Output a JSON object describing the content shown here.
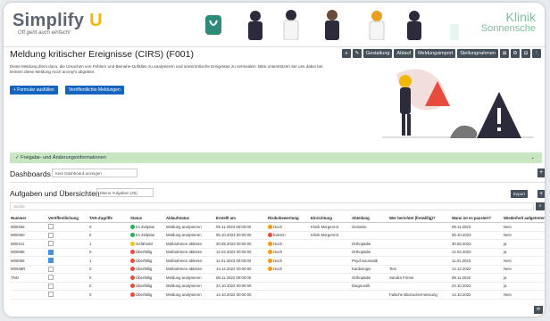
{
  "header": {
    "logo_text": "Simplify",
    "logo_accent": "U",
    "slogan": "Oft geht auch einfach!",
    "clinic_line1": "Klinik",
    "clinic_line2": "Sonnensche"
  },
  "page": {
    "title": "Meldung kritischer Ereignisse (CIRS) (F001)",
    "description": "Diese Meldung dient dazu, die Ursachen von Fehlern und Beinahe-Unfällen zu analysieren und somit kritische Ereignisse zu vermeiden. Bitte unterstützen Sie uns dabei bei keinem diese Meldung Auch anonym abgeben.",
    "btn_fill": "+ Formular ausfüllen",
    "btn_published": "Veröffentlichte Meldungen"
  },
  "toolbar": [
    "≡",
    "✎",
    "Gestaltung",
    "Ablauf",
    "Meldungsimport",
    "Stellungnahmen",
    "⊞",
    "⚙",
    "⊟",
    "⋮"
  ],
  "banner": {
    "label": "Freigabe- und Änderungsinformationen",
    "chevron": "⌄"
  },
  "dashboards": {
    "label": "Dashboards",
    "select": "Kein Dashboard anzeigen",
    "plus": "+"
  },
  "tasks": {
    "label": "Aufgaben und Übersichten",
    "select": "Meine Aufgaben (25)",
    "export": "Export",
    "plus": "+"
  },
  "search_placeholder": "Suche",
  "table": {
    "headers": [
      "Nummer",
      "Veröffentlichung",
      "TAN-Zugriffe",
      "Status",
      "Ablaufstatus",
      "Erstellt am",
      "Risikobewertung",
      "Einrichtung",
      "Abteilung",
      "Wer berichtet (freiwillig)?",
      "Wann ist es passiert?",
      "Wiederholt aufgetreten?"
    ],
    "rows": [
      {
        "nr": "M00466",
        "pub": false,
        "tan": "0",
        "status": "Im Zeitplan",
        "sc": "#27ae60",
        "ablauf": "Meldung analysieren",
        "erstellt": "09.11.2023 00:00:00",
        "risk": "Hoch",
        "rc": "#f39c12",
        "einr": "Klinik Morgenrot",
        "abt": "Geriatrie",
        "wer": "",
        "wann": "09.11.2023",
        "wied": "Nein"
      },
      {
        "nr": "M00450",
        "pub": false,
        "tan": "0",
        "status": "Im Zeitplan",
        "sc": "#27ae60",
        "ablauf": "Meldung analysieren",
        "erstellt": "05.10.2023 00:00:00",
        "risk": "Extrem",
        "rc": "#e74c3c",
        "einr": "Klinik Morgenrot",
        "abt": "",
        "wer": "",
        "wann": "05.10.2023",
        "wied": "Nein"
      },
      {
        "nr": "M00411",
        "pub": false,
        "tan": "1",
        "status": "Gefährdet",
        "sc": "#f1c40f",
        "ablauf": "Maßnahmen ableiten",
        "erstellt": "30.05.2023 00:00:00",
        "risk": "Hoch",
        "rc": "#f39c12",
        "einr": "",
        "abt": "Orthopädie",
        "wer": "",
        "wann": "30.05.2023",
        "wied": "ja"
      },
      {
        "nr": "M00086",
        "pub": true,
        "tan": "0",
        "status": "Überfällig",
        "sc": "#e74c3c",
        "ablauf": "Maßnahmen ableiten",
        "erstellt": "12.04.2023 00:00:00",
        "risk": "Hoch",
        "rc": "#f39c12",
        "einr": "",
        "abt": "Orthopädie",
        "wer": "",
        "wann": "12.04.2023",
        "wied": "ja"
      },
      {
        "nr": "M00056",
        "pub": true,
        "tan": "1",
        "status": "Überfällig",
        "sc": "#e74c3c",
        "ablauf": "Maßnahmen ableiten",
        "erstellt": "11.01.2023 00:00:00",
        "risk": "Hoch",
        "rc": "#f39c12",
        "einr": "",
        "abt": "Psychosomatik",
        "wer": "",
        "wann": "11.01.2023",
        "wied": "Nein"
      },
      {
        "nr": "M0049R",
        "pub": false,
        "tan": "0",
        "status": "Überfällig",
        "sc": "#e74c3c",
        "ablauf": "Maßnahmen ableiten",
        "erstellt": "14.12.2022 00:00:00",
        "risk": "Hoch",
        "rc": "#f39c12",
        "einr": "",
        "abt": "Kardiologie",
        "wer": "Test",
        "wann": "14.12.2022",
        "wied": "Nein"
      },
      {
        "nr": "TNO",
        "pub": false,
        "tan": "0",
        "status": "Überfällig",
        "sc": "#e74c3c",
        "ablauf": "Meldung analysieren",
        "erstellt": "08.11.2022 00:00:00",
        "risk": "",
        "rc": "",
        "einr": "",
        "abt": "Orthopädie",
        "wer": "Sandra Förste",
        "wann": "08.11.2022",
        "wied": "ja"
      },
      {
        "nr": "",
        "pub": false,
        "tan": "0",
        "status": "Überfällig",
        "sc": "#e74c3c",
        "ablauf": "Meldung analysieren",
        "erstellt": "24.10.2022 00:00:00",
        "risk": "",
        "rc": "",
        "einr": "",
        "abt": "Diagnostik",
        "wer": "",
        "wann": "24.10.2022",
        "wied": "ja"
      },
      {
        "nr": "",
        "pub": false,
        "tan": "0",
        "status": "Überfällig",
        "sc": "#e74c3c",
        "ablauf": "Meldung analysieren",
        "erstellt": "14.10.2022 00:00:00",
        "risk": "",
        "rc": "",
        "einr": "",
        "abt": "",
        "wer": "Falsche Blutzuckermessung",
        "wann": "14.10.2022",
        "wied": "Nein"
      }
    ]
  }
}
